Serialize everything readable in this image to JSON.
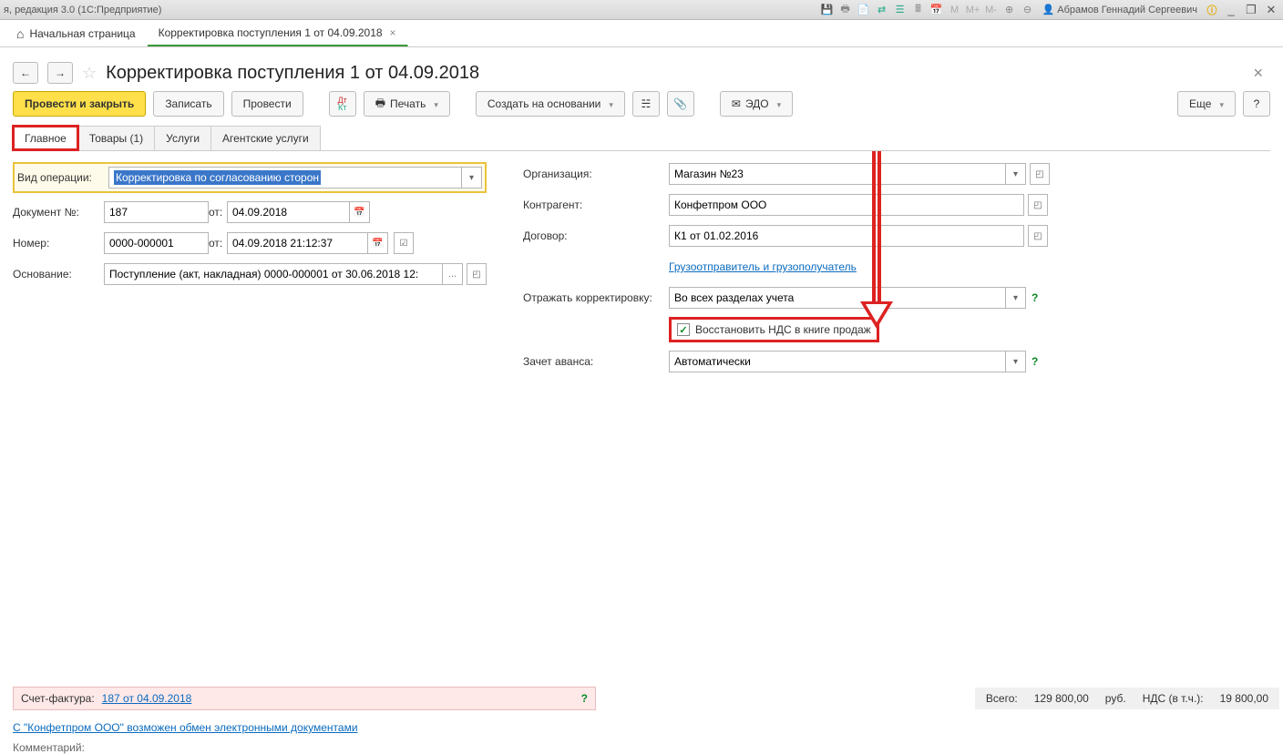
{
  "titlebar": {
    "text": "я, редакция 3.0  (1С:Предприятие)",
    "user": "Абрамов Геннадий Сергеевич"
  },
  "tabs": {
    "home": "Начальная страница",
    "doc": "Корректировка поступления 1 от 04.09.2018"
  },
  "page": {
    "title": "Корректировка поступления 1 от 04.09.2018"
  },
  "toolbar": {
    "post_close": "Провести и закрыть",
    "save": "Записать",
    "post": "Провести",
    "print": "Печать",
    "create_by": "Создать на основании",
    "edo": "ЭДО",
    "more": "Еще",
    "help": "?"
  },
  "formtabs": {
    "main": "Главное",
    "goods": "Товары (1)",
    "services": "Услуги",
    "agent": "Агентские услуги"
  },
  "left": {
    "op_type_label": "Вид операции:",
    "op_type_value": "Корректировка по согласованию сторон",
    "doc_no_label": "Документ №:",
    "doc_no_value": "187",
    "from1": "от:",
    "doc_date": "04.09.2018",
    "num_label": "Номер:",
    "num_value": "0000-000001",
    "from2": "от:",
    "num_date": "04.09.2018 21:12:37",
    "basis_label": "Основание:",
    "basis_value": "Поступление (акт, накладная) 0000-000001 от 30.06.2018 12:"
  },
  "right": {
    "org_label": "Организация:",
    "org_value": "Магазин №23",
    "contr_label": "Контрагент:",
    "contr_value": "Конфетпром ООО",
    "dog_label": "Договор:",
    "dog_value": "К1 от 01.02.2016",
    "shipper_link": "Грузоотправитель и грузополучатель",
    "reflect_label": "Отражать корректировку:",
    "reflect_value": "Во всех разделах учета",
    "restore_vat": "Восстановить НДС в книге продаж",
    "advance_label": "Зачет аванса:",
    "advance_value": "Автоматически"
  },
  "footer": {
    "invoice_label": "Счет-фактура:",
    "invoice_link": "187 от 04.09.2018",
    "edo_link": "С \"Конфетпром ООО\" возможен обмен электронными документами",
    "comment_label": "Комментарий:",
    "total_label": "Всего:",
    "total_value": "129 800,00",
    "currency": "руб.",
    "vat_label": "НДС (в т.ч.):",
    "vat_value": "19 800,00"
  }
}
